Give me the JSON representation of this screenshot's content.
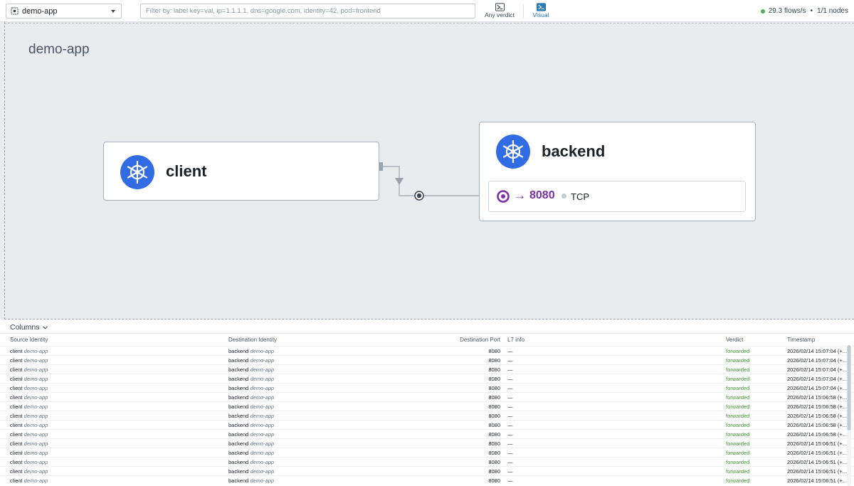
{
  "topbar": {
    "namespace": "demo-app",
    "filter_placeholder": "Filter by: label key=val, ip=1.1.1.1, dns=google.com, identity=42, pod=frontend",
    "verdict_label": "Any verdict",
    "visual_label": "Visual",
    "flows_rate": "29.3 flows/s",
    "bullet": "•",
    "nodes": "1/1 nodes"
  },
  "map": {
    "namespace_title": "demo-app",
    "client": {
      "name": "client"
    },
    "backend": {
      "name": "backend",
      "port_arrow": "→",
      "port": "8080",
      "protocol": "TCP"
    }
  },
  "panel": {
    "columns_label": "Columns",
    "headers": {
      "source": "Source Identity",
      "destination": "Destination Identity",
      "port": "Destination Port",
      "l7": "L7 info",
      "verdict": "Verdict",
      "timestamp": "Timestamp"
    },
    "rows": [
      {
        "src": "client",
        "src_ns": "demo-app",
        "dst": "backend",
        "dst_ns": "demo-app",
        "port": "8080",
        "l7": "—",
        "verdict": "forwarded",
        "ts": "2026/02/14 15:07:04 (+..."
      },
      {
        "src": "client",
        "src_ns": "demo-app",
        "dst": "backend",
        "dst_ns": "demo-app",
        "port": "8080",
        "l7": "—",
        "verdict": "forwarded",
        "ts": "2026/02/14 15:07:04 (+..."
      },
      {
        "src": "client",
        "src_ns": "demo-app",
        "dst": "backend",
        "dst_ns": "demo-app",
        "port": "8080",
        "l7": "—",
        "verdict": "forwarded",
        "ts": "2026/02/14 15:07:04 (+..."
      },
      {
        "src": "client",
        "src_ns": "demo-app",
        "dst": "backend",
        "dst_ns": "demo-app",
        "port": "8080",
        "l7": "—",
        "verdict": "forwarded",
        "ts": "2026/02/14 15:07:04 (+..."
      },
      {
        "src": "client",
        "src_ns": "demo-app",
        "dst": "backend",
        "dst_ns": "demo-app",
        "port": "8080",
        "l7": "—",
        "verdict": "forwarded",
        "ts": "2026/02/14 15:07:04 (+..."
      },
      {
        "src": "client",
        "src_ns": "demo-app",
        "dst": "backend",
        "dst_ns": "demo-app",
        "port": "8080",
        "l7": "—",
        "verdict": "forwarded",
        "ts": "2026/02/14 15:06:58 (+..."
      },
      {
        "src": "client",
        "src_ns": "demo-app",
        "dst": "backend",
        "dst_ns": "demo-app",
        "port": "8080",
        "l7": "—",
        "verdict": "forwarded",
        "ts": "2026/02/14 15:06:58 (+..."
      },
      {
        "src": "client",
        "src_ns": "demo-app",
        "dst": "backend",
        "dst_ns": "demo-app",
        "port": "8080",
        "l7": "—",
        "verdict": "forwarded",
        "ts": "2026/02/14 15:06:58 (+..."
      },
      {
        "src": "client",
        "src_ns": "demo-app",
        "dst": "backend",
        "dst_ns": "demo-app",
        "port": "8080",
        "l7": "—",
        "verdict": "forwarded",
        "ts": "2026/02/14 15:06:58 (+..."
      },
      {
        "src": "client",
        "src_ns": "demo-app",
        "dst": "backend",
        "dst_ns": "demo-app",
        "port": "8080",
        "l7": "—",
        "verdict": "forwarded",
        "ts": "2026/02/14 15:06:58 (+..."
      },
      {
        "src": "client",
        "src_ns": "demo-app",
        "dst": "backend",
        "dst_ns": "demo-app",
        "port": "8080",
        "l7": "—",
        "verdict": "forwarded",
        "ts": "2026/02/14 15:06:51 (+..."
      },
      {
        "src": "client",
        "src_ns": "demo-app",
        "dst": "backend",
        "dst_ns": "demo-app",
        "port": "8080",
        "l7": "—",
        "verdict": "forwarded",
        "ts": "2026/02/14 15:06:51 (+..."
      },
      {
        "src": "client",
        "src_ns": "demo-app",
        "dst": "backend",
        "dst_ns": "demo-app",
        "port": "8080",
        "l7": "—",
        "verdict": "forwarded",
        "ts": "2026/02/14 15:06:51 (+..."
      },
      {
        "src": "client",
        "src_ns": "demo-app",
        "dst": "backend",
        "dst_ns": "demo-app",
        "port": "8080",
        "l7": "—",
        "verdict": "forwarded",
        "ts": "2026/02/14 15:06:51 (+..."
      },
      {
        "src": "client",
        "src_ns": "demo-app",
        "dst": "backend",
        "dst_ns": "demo-app",
        "port": "8080",
        "l7": "—",
        "verdict": "forwarded",
        "ts": "2026/02/14 15:06:51 (+..."
      }
    ]
  },
  "colors": {
    "accent": "#2a7ab8",
    "k8s_blue": "#326ce5",
    "port_purple": "#7b2fa8",
    "forwarded_green": "#3e9a2e",
    "status_green": "#4caf50"
  },
  "icons": {
    "namespace": "namespace-icon",
    "caret": "chevron-down-icon",
    "verdict": "verdict-icon",
    "visual": "visual-icon",
    "kubernetes": "kubernetes-icon",
    "port": "port-target-icon"
  }
}
